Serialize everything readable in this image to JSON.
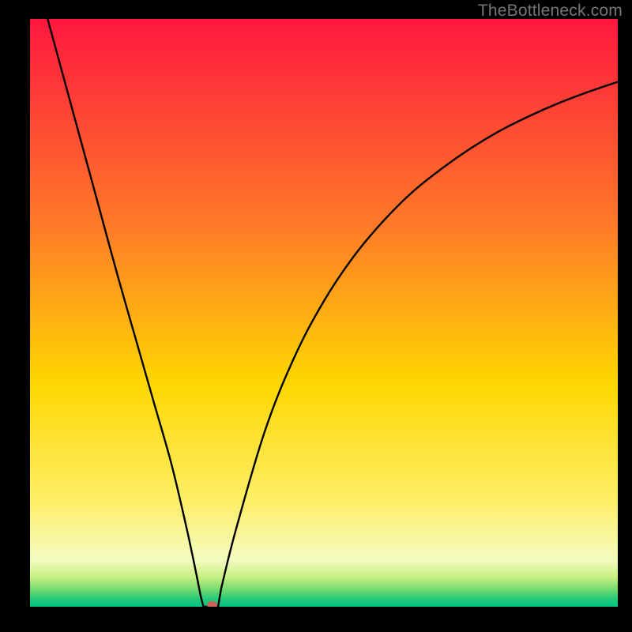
{
  "watermark": "TheBottleneck.com",
  "colors": {
    "top": "#fe183f",
    "mid_upper": "#ff7a28",
    "mid": "#fed701",
    "mid_lower": "#feef67",
    "low": "#f4fbc1",
    "band_yellowgreen": "#c7ef82",
    "band_green1": "#77da6f",
    "band_green2": "#2bcb78",
    "bottom": "#00c483",
    "curve": "#000000",
    "marker": "#c9625a",
    "frame_bg": "#000000"
  },
  "chart_data": {
    "type": "line",
    "title": "",
    "xlabel": "",
    "ylabel": "",
    "xlim": [
      0,
      100
    ],
    "ylim": [
      0,
      100
    ],
    "series": [
      {
        "name": "bottleneck-curve",
        "x": [
          3,
          6,
          9,
          12,
          15,
          18,
          21,
          24,
          26.5,
          28,
          29,
          30,
          31,
          32.5,
          35,
          40,
          45,
          50,
          55,
          60,
          65,
          70,
          75,
          80,
          85,
          90,
          95,
          100
        ],
        "y": [
          100,
          89,
          78,
          67,
          56,
          45.5,
          35,
          24.5,
          14,
          7,
          2,
          0,
          0,
          3,
          13,
          30,
          42.5,
          52,
          59.5,
          65.5,
          70.5,
          74.5,
          78,
          81,
          83.5,
          85.7,
          87.6,
          89.3
        ]
      }
    ],
    "marker": {
      "x": 31,
      "y": 0.3
    },
    "flat_segment": {
      "x0": 29.5,
      "x1": 32,
      "y": 0
    }
  }
}
